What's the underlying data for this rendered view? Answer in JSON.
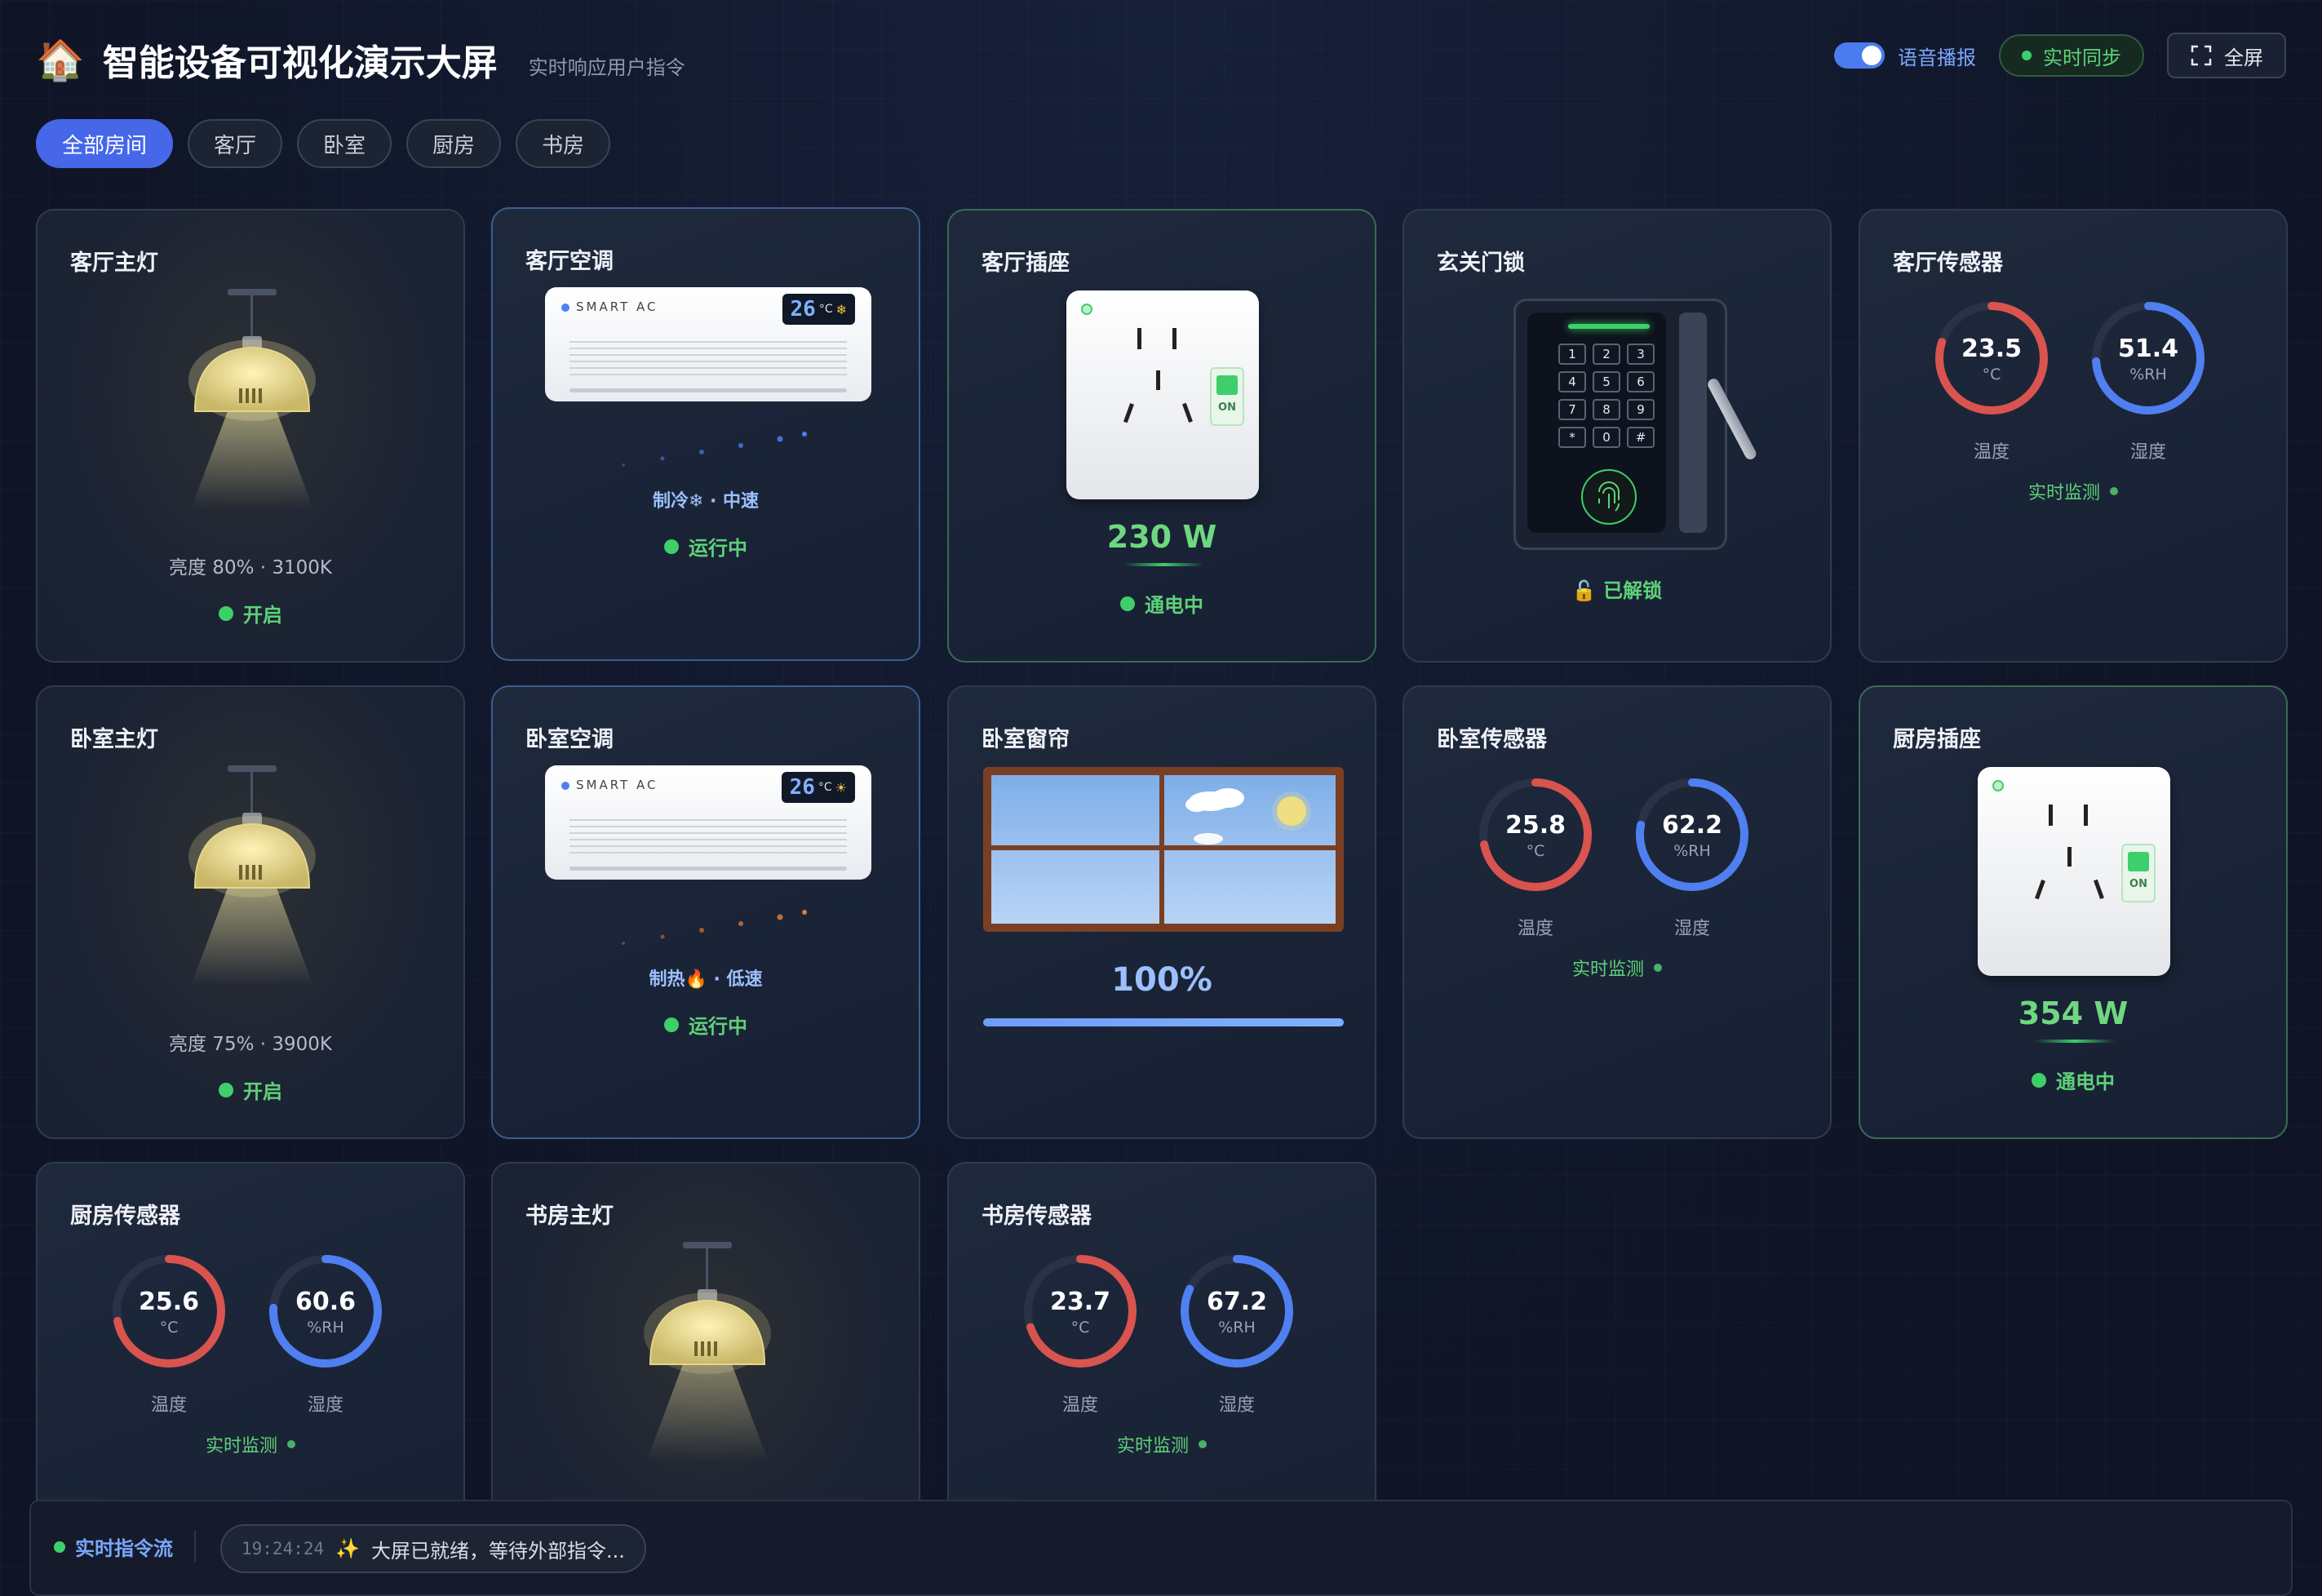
{
  "header": {
    "logo": "🏠",
    "title": "智能设备可视化演示大屏",
    "subtitle": "实时响应用户指令",
    "voice_label": "语音播报",
    "sync_label": "实时同步",
    "fullscreen_label": "全屏"
  },
  "tabs": [
    {
      "label": "全部房间",
      "active": true
    },
    {
      "label": "客厅"
    },
    {
      "label": "卧室"
    },
    {
      "label": "厨房"
    },
    {
      "label": "书房"
    }
  ],
  "cards": {
    "living_light": {
      "title": "客厅主灯",
      "info": "亮度 80% · 3100K",
      "status": "开启"
    },
    "living_ac": {
      "title": "客厅空调",
      "brand": "SMART AC",
      "temp": "26",
      "unit": "°C",
      "mode_icon": "❄",
      "mode": "制冷❄ · 中速",
      "status": "运行中"
    },
    "living_socket": {
      "title": "客厅插座",
      "switch": "ON",
      "power": "230 W",
      "status": "通电中"
    },
    "door_lock": {
      "title": "玄关门锁",
      "keys": [
        "1",
        "2",
        "3",
        "4",
        "5",
        "6",
        "7",
        "8",
        "9",
        "*",
        "0",
        "#"
      ],
      "status": "🔓 已解锁"
    },
    "living_sensor": {
      "title": "客厅传感器",
      "temp": "23.5",
      "temp_unit": "°C",
      "temp_label": "温度",
      "hum": "51.4",
      "hum_unit": "%RH",
      "hum_label": "湿度",
      "monitor": "实时监测"
    },
    "bedroom_light": {
      "title": "卧室主灯",
      "info": "亮度 75% · 3900K",
      "status": "开启"
    },
    "bedroom_ac": {
      "title": "卧室空调",
      "brand": "SMART AC",
      "temp": "26",
      "unit": "°C",
      "mode_icon": "☀",
      "mode": "制热🔥 · 低速",
      "status": "运行中"
    },
    "bedroom_curtain": {
      "title": "卧室窗帘",
      "value": "100%",
      "level": 1.0
    },
    "bedroom_sensor": {
      "title": "卧室传感器",
      "temp": "25.8",
      "temp_unit": "°C",
      "temp_label": "温度",
      "hum": "62.2",
      "hum_unit": "%RH",
      "hum_label": "湿度",
      "monitor": "实时监测"
    },
    "kitchen_socket": {
      "title": "厨房插座",
      "switch": "ON",
      "power": "354 W",
      "status": "通电中"
    },
    "kitchen_sensor": {
      "title": "厨房传感器",
      "temp": "25.6",
      "temp_unit": "°C",
      "temp_label": "温度",
      "hum": "60.6",
      "hum_unit": "%RH",
      "hum_label": "湿度",
      "monitor": "实时监测"
    },
    "study_light": {
      "title": "书房主灯"
    },
    "study_sensor": {
      "title": "书房传感器",
      "temp": "23.7",
      "temp_unit": "°C",
      "temp_label": "温度",
      "hum": "67.2",
      "hum_unit": "%RH",
      "hum_label": "湿度",
      "monitor": "实时监测"
    }
  },
  "command_stream": {
    "label": "实时指令流",
    "time": "19:24:24",
    "icon": "✨",
    "message": "大屏已就绪，等待外部指令..."
  },
  "colors": {
    "accent": "#4667e8",
    "on_green": "#5fd17a",
    "temp_red": "#d9534f",
    "hum_blue": "#4f7ff0"
  }
}
